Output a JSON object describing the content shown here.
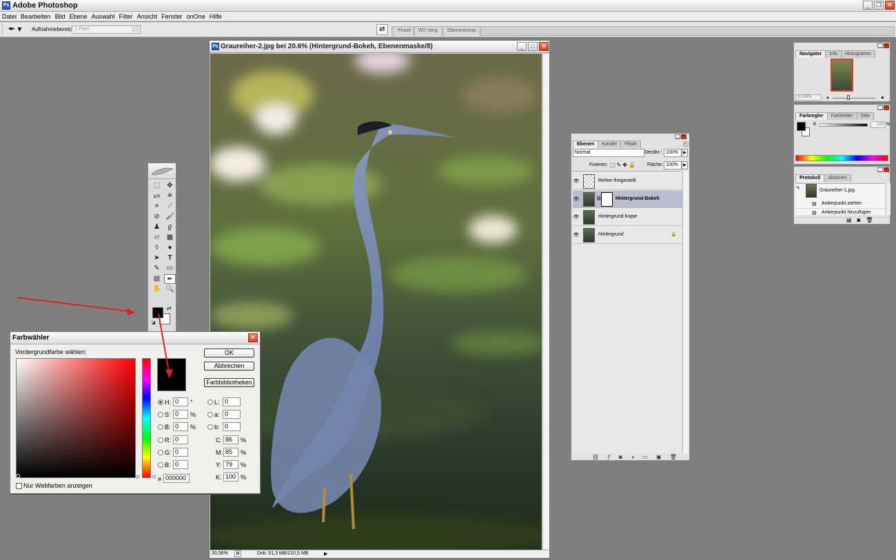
{
  "app": {
    "title": "Adobe Photoshop"
  },
  "menu": [
    "Datei",
    "Bearbeiten",
    "Bild",
    "Ebene",
    "Auswahl",
    "Filter",
    "Ansicht",
    "Fenster",
    "onOne",
    "Hilfe"
  ],
  "options": {
    "sample_label": "Aufnahmebereich:",
    "sample_value": "1 Pixel",
    "well_tabs": [
      "Pinsel",
      "WZ-Vorg.",
      "Ebenenkomp."
    ]
  },
  "document": {
    "title": "Graureiher-2.jpg bei 20.6% (Hintergrund-Bokeh, Ebenenmaske/8)",
    "zoom": "20,56%",
    "doc_size": "Dok: 51,3 MB/210,5 MB"
  },
  "picker": {
    "title": "Farbwähler",
    "prompt": "Vordergrundfarbe wählen:",
    "ok": "OK",
    "cancel": "Abbrechen",
    "libraries": "Farbbibliotheken",
    "web_only": "Nur Webfarben anzeigen",
    "hsb": [
      {
        "label": "H:",
        "value": "0",
        "unit": "°"
      },
      {
        "label": "S:",
        "value": "0",
        "unit": "%"
      },
      {
        "label": "B:",
        "value": "0",
        "unit": "%"
      }
    ],
    "lab": [
      {
        "label": "L:",
        "value": "0"
      },
      {
        "label": "a:",
        "value": "0"
      },
      {
        "label": "b:",
        "value": "0"
      }
    ],
    "rgb": [
      {
        "label": "R:",
        "value": "0"
      },
      {
        "label": "G:",
        "value": "0"
      },
      {
        "label": "B:",
        "value": "0"
      }
    ],
    "cmyk": [
      {
        "label": "C:",
        "value": "86",
        "unit": "%"
      },
      {
        "label": "M:",
        "value": "85",
        "unit": "%"
      },
      {
        "label": "Y:",
        "value": "79",
        "unit": "%"
      },
      {
        "label": "K:",
        "value": "100",
        "unit": "%"
      }
    ],
    "hex_label": "#",
    "hex": "000000"
  },
  "navigator": {
    "tabs": [
      "Navigator",
      "Info",
      "Histogramm"
    ],
    "zoom": "20,56%"
  },
  "color_panel": {
    "tabs": [
      "Farbregler",
      "Farbfelder",
      "Stile"
    ],
    "slider_label": "K",
    "value": "100",
    "unit": "%"
  },
  "history": {
    "tabs": [
      "Protokoll",
      "Aktionen"
    ],
    "snapshot": "Graureiher-1.jpg",
    "items": [
      "Ankerpunkt ziehen",
      "Ankerpunkt hinzufügen"
    ]
  },
  "layers": {
    "tabs": [
      "Ebenen",
      "Kanäle",
      "Pfade"
    ],
    "blend_mode": "Normal",
    "opacity_label": "Deckkr.:",
    "opacity": "100%",
    "lock_label": "Fixieren:",
    "fill_label": "Fläche:",
    "fill": "100%",
    "rows": [
      "Reiher-freigestellt",
      "Hintergrund-Bokeh",
      "Hintergrund Kopie",
      "Hintergrund"
    ]
  },
  "colors": {
    "foreground": "#000000",
    "accent_red": "#e02020"
  }
}
